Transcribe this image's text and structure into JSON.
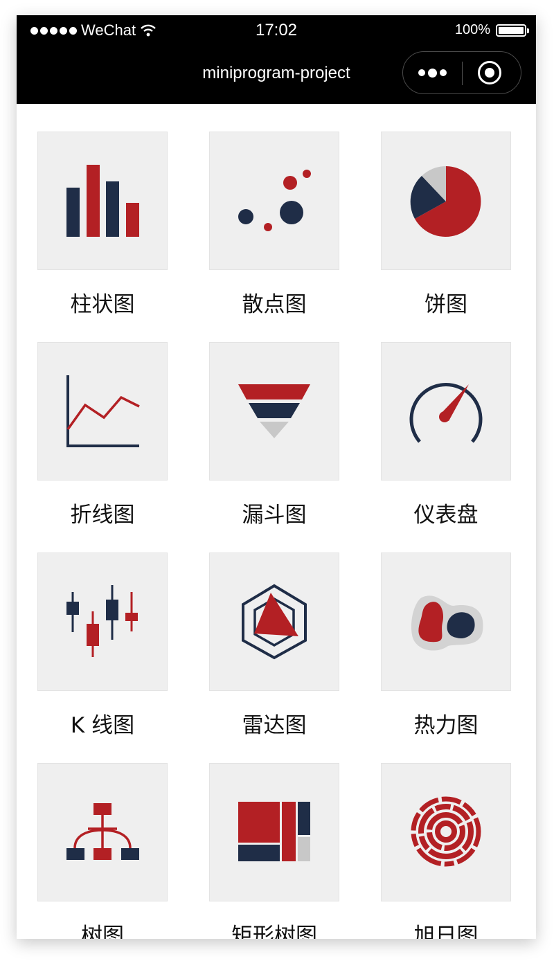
{
  "status_bar": {
    "carrier": "WeChat",
    "time": "17:02",
    "battery": "100%"
  },
  "navbar": {
    "title": "miniprogram-project"
  },
  "charts": [
    {
      "label": "柱状图",
      "icon": "bar-chart-icon"
    },
    {
      "label": "散点图",
      "icon": "scatter-chart-icon"
    },
    {
      "label": "饼图",
      "icon": "pie-chart-icon"
    },
    {
      "label": "折线图",
      "icon": "line-chart-icon"
    },
    {
      "label": "漏斗图",
      "icon": "funnel-chart-icon"
    },
    {
      "label": "仪表盘",
      "icon": "gauge-chart-icon"
    },
    {
      "label": "K 线图",
      "icon": "candlestick-chart-icon"
    },
    {
      "label": "雷达图",
      "icon": "radar-chart-icon"
    },
    {
      "label": "热力图",
      "icon": "heatmap-chart-icon"
    },
    {
      "label": "树图",
      "icon": "tree-chart-icon"
    },
    {
      "label": "矩形树图",
      "icon": "treemap-chart-icon"
    },
    {
      "label": "旭日图",
      "icon": "sunburst-chart-icon"
    }
  ],
  "colors": {
    "red": "#b32024",
    "navy": "#1f2d47",
    "gray": "#c8c8c8",
    "tile": "#efefef"
  }
}
